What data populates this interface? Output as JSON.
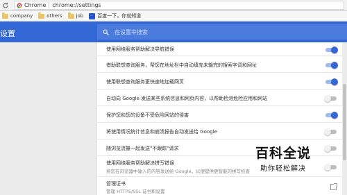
{
  "browser": {
    "chip_label": "Chrome",
    "url": "chrome://settings",
    "bookmarks": [
      {
        "label": "company"
      },
      {
        "label": "others"
      },
      {
        "label": "job"
      },
      {
        "label": "百度一下，你就知道"
      }
    ]
  },
  "header": {
    "title": "设置",
    "search_placeholder": "在设置中搜索"
  },
  "settings": [
    {
      "label": "使用网络服务帮助解决导航错误",
      "sub": "",
      "control": "toggle",
      "on": true
    },
    {
      "label": "借助联想查询服务，帮您在地址栏中自动填充未输完的搜索字词和网址",
      "sub": "",
      "control": "toggle",
      "on": true
    },
    {
      "label": "使用联想查询服务更快速地加载网页",
      "sub": "",
      "control": "toggle",
      "on": true
    },
    {
      "label": "自动向 Google 发送某些系统信息和网页内容，以帮助检测危险应用和网站",
      "sub": "",
      "control": "toggle",
      "on": false
    },
    {
      "label": "保护您和您的设备不受危险网站的侵害",
      "sub": "",
      "control": "toggle",
      "on": true
    },
    {
      "label": "将使用情况统计信息和崩溃报告自动发送给 Google",
      "sub": "",
      "control": "toggle",
      "on": false
    },
    {
      "label": "随浏览流量一起发送\"不跟踪\"请求",
      "sub": "",
      "control": "toggle",
      "on": false
    },
    {
      "label": "使用网络服务帮助解决拼写错误",
      "sub": "将您在浏览器中输入的内容发送给 Google，以便提供更智能的拼写检查",
      "control": "toggle",
      "on": false
    },
    {
      "label": "管理证书",
      "sub": "管理 HTTPS/SSL 证书和设置",
      "control": "external"
    }
  ],
  "colors": {
    "header_bg": "#3367d6",
    "toggle_on": "#3367d6",
    "toggle_off": "#bdbdbd"
  },
  "watermark": {
    "big": "百科全说",
    "small": "助你轻松解决"
  }
}
